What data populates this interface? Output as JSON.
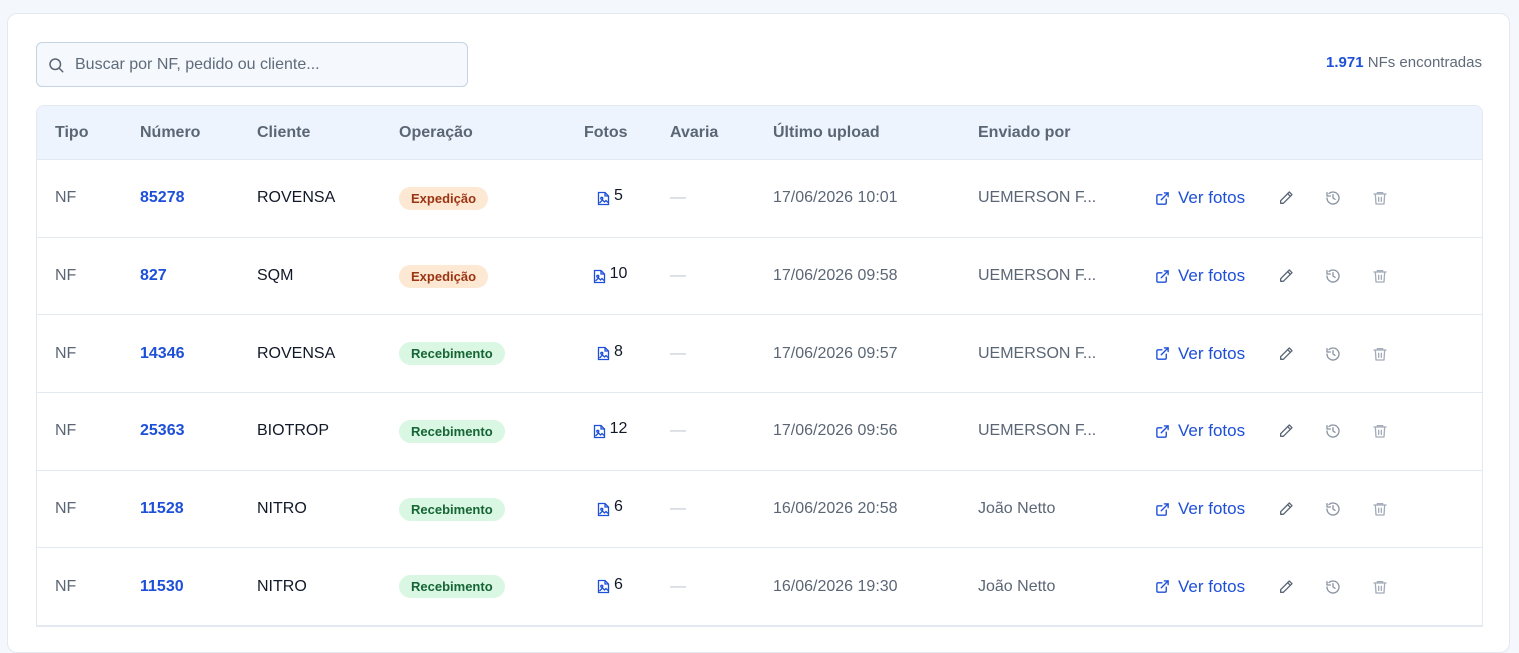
{
  "search": {
    "placeholder": "Buscar por NF, pedido ou cliente...",
    "value": ""
  },
  "summary": {
    "count": "1.971",
    "label": "NFs encontradas"
  },
  "columns": {
    "tipo": "Tipo",
    "numero": "Número",
    "cliente": "Cliente",
    "operacao": "Operação",
    "fotos": "Fotos",
    "avaria": "Avaria",
    "ultimo_upload": "Último upload",
    "enviado_por": "Enviado por"
  },
  "action_labels": {
    "ver_fotos": "Ver fotos"
  },
  "icons": {
    "search": "search-icon",
    "photo": "image-file-icon",
    "external": "external-link-icon",
    "edit": "pencil-icon",
    "history": "history-icon",
    "delete": "trash-icon"
  },
  "colors": {
    "link": "#1e4fd8",
    "expedicao_bg": "#fde8d3",
    "recebimento_bg": "#d9f7e3"
  },
  "rows": [
    {
      "tipo": "NF",
      "numero": "85278",
      "cliente": "ROVENSA",
      "operacao": "Expedição",
      "op_kind": "exp",
      "fotos": "5",
      "avaria": "—",
      "upload": "17/06/2026 10:01",
      "enviado": "UEMERSON F..."
    },
    {
      "tipo": "NF",
      "numero": "827",
      "cliente": "SQM",
      "operacao": "Expedição",
      "op_kind": "exp",
      "fotos": "10",
      "avaria": "—",
      "upload": "17/06/2026 09:58",
      "enviado": "UEMERSON F..."
    },
    {
      "tipo": "NF",
      "numero": "14346",
      "cliente": "ROVENSA",
      "operacao": "Recebimento",
      "op_kind": "rec",
      "fotos": "8",
      "avaria": "—",
      "upload": "17/06/2026 09:57",
      "enviado": "UEMERSON F..."
    },
    {
      "tipo": "NF",
      "numero": "25363",
      "cliente": "BIOTROP",
      "operacao": "Recebimento",
      "op_kind": "rec",
      "fotos": "12",
      "avaria": "—",
      "upload": "17/06/2026 09:56",
      "enviado": "UEMERSON F..."
    },
    {
      "tipo": "NF",
      "numero": "11528",
      "cliente": "NITRO",
      "operacao": "Recebimento",
      "op_kind": "rec",
      "fotos": "6",
      "avaria": "—",
      "upload": "16/06/2026 20:58",
      "enviado": "João Netto"
    },
    {
      "tipo": "NF",
      "numero": "11530",
      "cliente": "NITRO",
      "operacao": "Recebimento",
      "op_kind": "rec",
      "fotos": "6",
      "avaria": "—",
      "upload": "16/06/2026 19:30",
      "enviado": "João Netto"
    }
  ]
}
